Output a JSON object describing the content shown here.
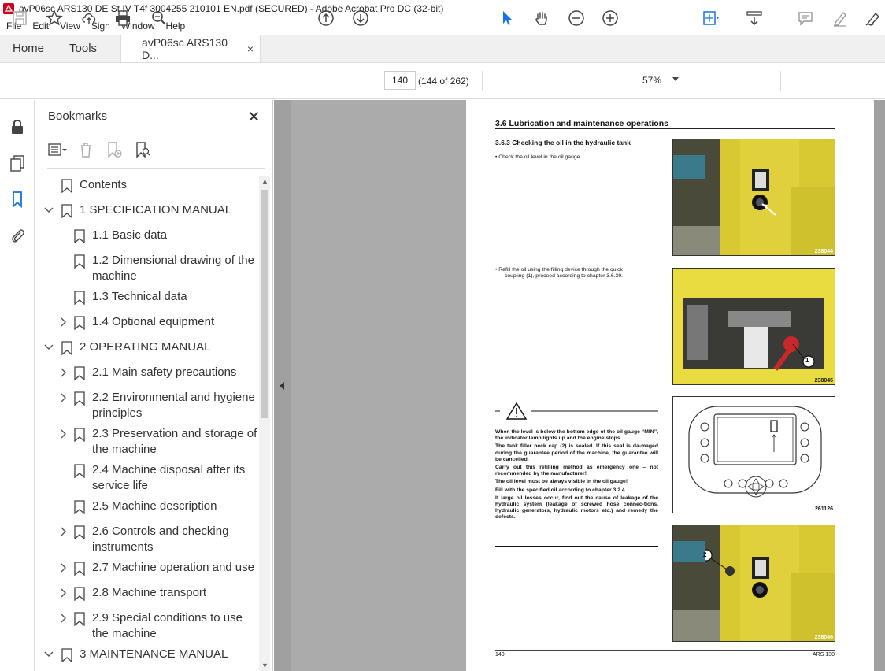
{
  "window": {
    "title": "avP06sc ARS130 DE St IV T4f 3004255 210101 EN.pdf (SECURED) - Adobe Acrobat Pro DC (32-bit)"
  },
  "menu": [
    "File",
    "Edit",
    "View",
    "Sign",
    "Window",
    "Help"
  ],
  "tabs": {
    "home": "Home",
    "tools": "Tools",
    "document": "avP06sc ARS130 D...",
    "close": "×"
  },
  "toolbar": {
    "page_number": "140",
    "page_count": "(144 of 262)",
    "zoom": "57%"
  },
  "bookmarks_panel": {
    "title": "Bookmarks",
    "close": "✕",
    "items": [
      {
        "label": "Contents"
      },
      {
        "label": "1 SPECIFICATION MANUAL"
      },
      {
        "label": "1.1 Basic data"
      },
      {
        "label": "1.2 Dimensional drawing of the"
      },
      {
        "label": "machine"
      },
      {
        "label": "1.3 Technical data"
      },
      {
        "label": "1.4 Optional equipment"
      },
      {
        "label": "2 OPERATING MANUAL"
      },
      {
        "label": "2.1 Main safety precautions"
      },
      {
        "label": "2.2 Environmental and hygiene"
      },
      {
        "label": "principles"
      },
      {
        "label": "2.3 Preservation and storage of"
      },
      {
        "label": "the machine"
      },
      {
        "label": "2.4 Machine disposal after its"
      },
      {
        "label": "service life"
      },
      {
        "label": "2.5 Machine description"
      },
      {
        "label": "2.6 Controls and checking"
      },
      {
        "label": "instruments"
      },
      {
        "label": "2.7 Machine operation and use"
      },
      {
        "label": "2.8 Machine transport"
      },
      {
        "label": "2.9 Special conditions to use"
      },
      {
        "label": "the machine"
      },
      {
        "label": "3 MAINTENANCE MANUAL"
      }
    ]
  },
  "page": {
    "section": "3.6      Lubrication and maintenance operations",
    "subsection": "3.6.3      Checking the oil in the hydraulic tank",
    "bullet1": "•      Check the oil level in the oil gauge.",
    "bullet2a": "•      Refill the oil using the filling device through the quick",
    "bullet2b": "coupling (1), proceed according to chapter 3.6.39.",
    "warning": [
      "When the level is below the bottom edge of the oil gauge “MIN”, the indicator lamp lights up and the engine stops.",
      "The tank filler neck cap (2) is sealed. If this seal is da-maged during the guarantee period of the machine, the guarantee will be cancelled.",
      "Carry out this refilling method as emergency one – not recommended by the manufacturer!",
      "The oil level must be always visible in the oil gauge!",
      "Fill with the specified oil according to chapter 3.2.4.",
      "If large oil losses occur, find out the cause of leakage of the hydraulic system (leakage of screwed hose connec-tions, hydraulic generators, hydraulic motors etc.) and remedy the defects."
    ],
    "figures": [
      "238044",
      "238045",
      "261126",
      "238046"
    ],
    "callouts": [
      "1",
      "2"
    ],
    "footer_left": "140",
    "footer_right": "ARS 130"
  }
}
